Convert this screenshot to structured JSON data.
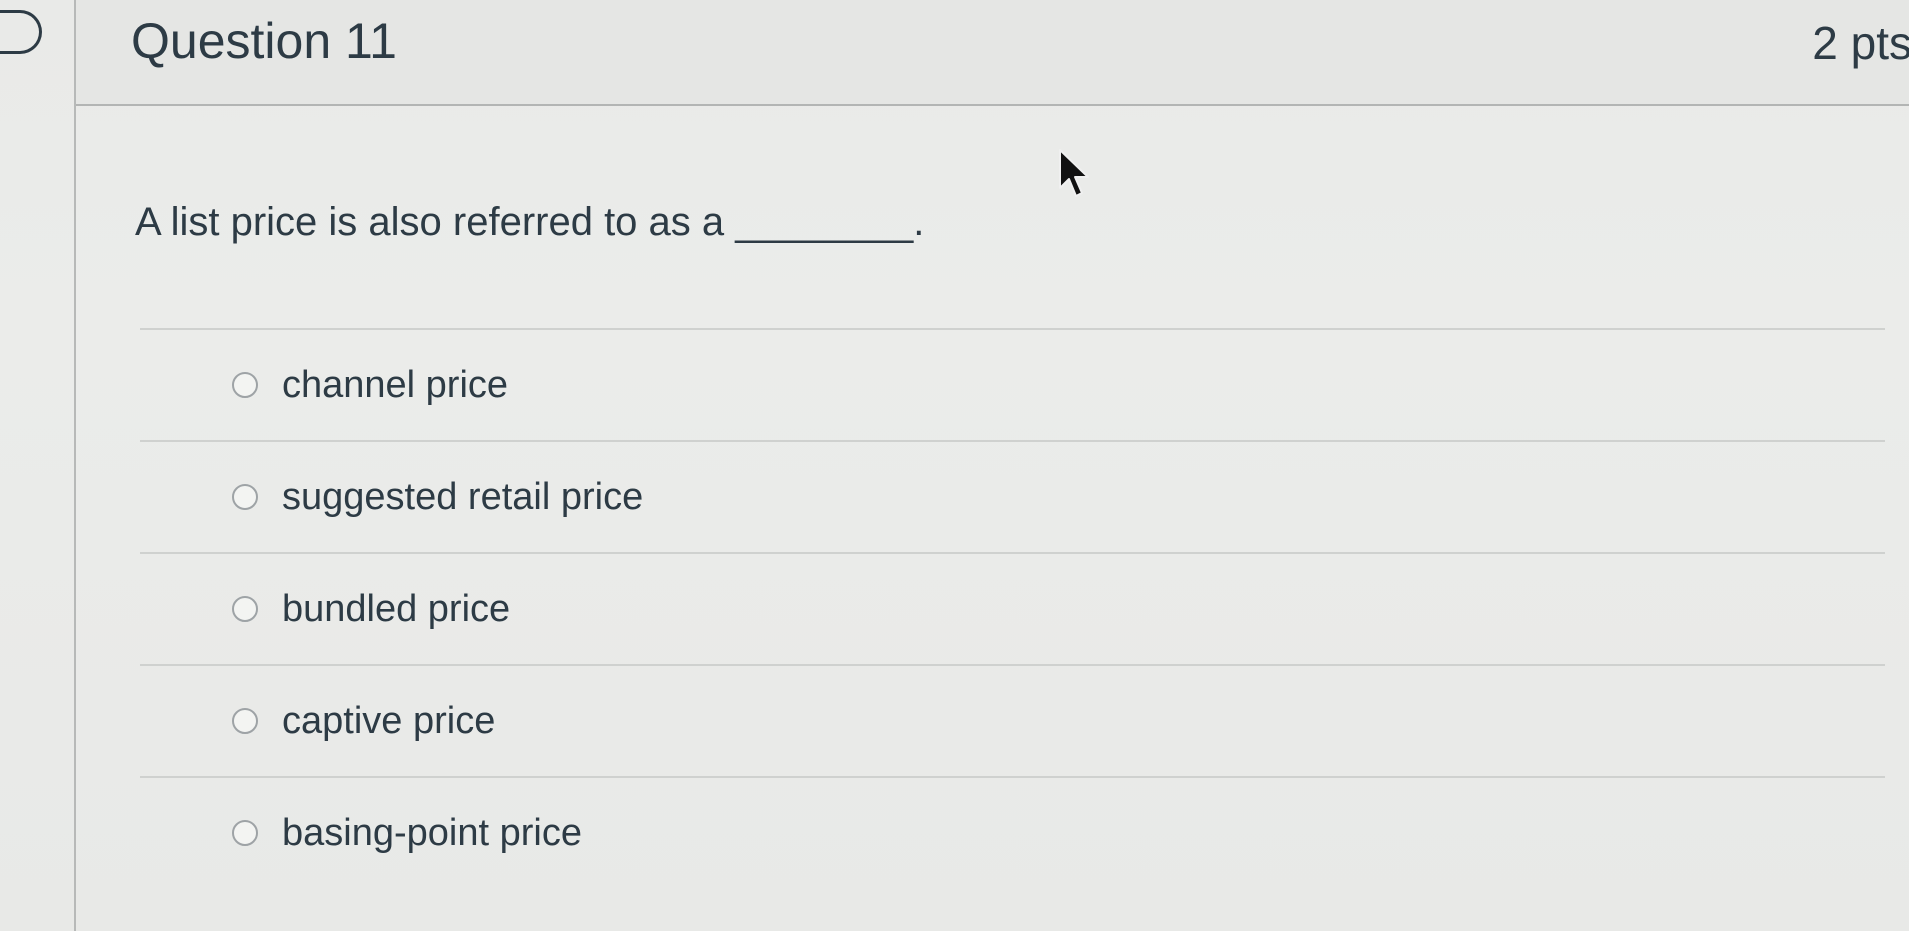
{
  "quiz": {
    "question_title": "Question 11",
    "points": "2 pts",
    "question_text": "A list price is also referred to as a ________.",
    "answers": [
      {
        "label": "channel price",
        "selected": false
      },
      {
        "label": "suggested retail price",
        "selected": false
      },
      {
        "label": "bundled price",
        "selected": false
      },
      {
        "label": "captive price",
        "selected": false
      },
      {
        "label": "basing-point price",
        "selected": false
      }
    ]
  },
  "icons": {
    "flag": "flag-question-icon",
    "cursor": "mouse-pointer-icon"
  },
  "colors": {
    "text": "#2d3b45",
    "background": "#e9eae8",
    "divider": "#cfd1cf"
  }
}
